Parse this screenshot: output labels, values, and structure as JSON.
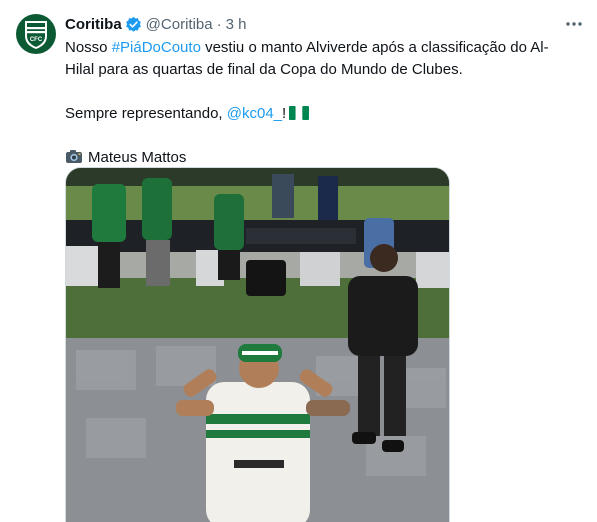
{
  "author": {
    "display_name": "Coritiba",
    "handle": "@Coritiba",
    "separator": "·",
    "time": "3 h",
    "avatar_icon": "coritiba-crest-icon",
    "verified_icon": "verified-badge-icon"
  },
  "tweet": {
    "line1_pre": "Nosso ",
    "hashtag": "#PiáDoCouto",
    "line1_post": " vestiu o manto Alviverde após a classificação do Al-",
    "line2": "Hilal para as quartas de final da Copa do Mundo de Clubes.",
    "line3_pre": "Sempre representando, ",
    "mention": "@kc04_",
    "line3_post": "!",
    "flag_icon": "nigeria-flag-icon",
    "camera_icon": "camera-icon",
    "credit": "Mateus Mattos"
  },
  "media": {
    "kind": "photo",
    "description_icon": "player-photo"
  },
  "colors": {
    "link": "#1d9bf0",
    "muted": "#536471",
    "text": "#0f1419",
    "brand_green": "#0b5a34"
  }
}
